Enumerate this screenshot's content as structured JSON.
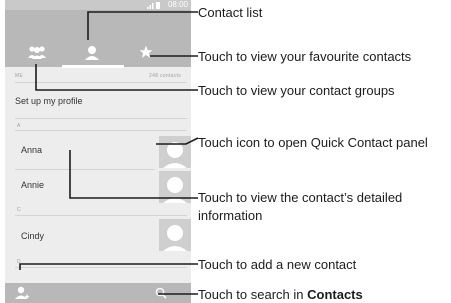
{
  "phone": {
    "status_time": "08:00",
    "me_label": "ME",
    "contact_count": "248 contacts",
    "setup_profile": "Set up my profile",
    "sections": [
      {
        "letter": "A",
        "contacts": [
          "Anna",
          "Annie"
        ]
      },
      {
        "letter": "C",
        "contacts": [
          "Cindy"
        ]
      },
      {
        "letter": "D",
        "contacts": []
      }
    ]
  },
  "callouts": {
    "contact_list": "Contact list",
    "favourites": "Touch to view your favourite contacts",
    "groups": "Touch to view your contact groups",
    "quick_contact": "Touch icon to open Quick Contact panel",
    "details_line1": "Touch to view the contact’s detailed",
    "details_line2": "information",
    "add_contact": "Touch to add a new contact",
    "search_prefix": "Touch to search in ",
    "search_app": "Contacts"
  }
}
